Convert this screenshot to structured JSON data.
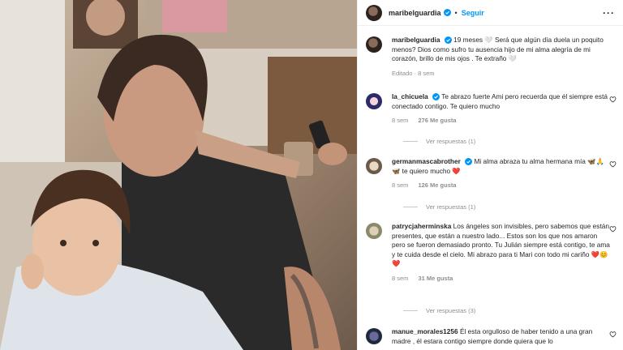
{
  "post": {
    "username": "maribelguardia",
    "follow_label": "Seguir",
    "caption_user": "maribelguardia",
    "caption_text": "19 meses 🤍 Será que algún día duela un poquito menos? Dios como sufro tu ausencia hijo de mi alma alegría de mi corazón, brillo de mis ojos . Te extraño 🤍",
    "edited": "Editado · 8 sem"
  },
  "comments": [
    {
      "user": "la_chicuela",
      "text": "Te abrazo fuerte Ami pero recuerda que él siempre está conectado contigo. Te quiero mucho",
      "time": "8 sem",
      "likes": "276 Me gusta",
      "replies": "Ver respuestas (1)"
    },
    {
      "user": "germanmascabrother",
      "text": "Mi alma abraza tu alma hermana mía 🦋🙏🦋 te quiero mucho ❤️",
      "time": "8 sem",
      "likes": "126 Me gusta",
      "replies": "Ver respuestas (1)"
    },
    {
      "user": "patrycjaherminska",
      "text": "Los ángeles son invisibles, pero sabemos que están presentes, que están a nuestro lado... Estos son los que nos amaron pero se fueron demasiado pronto. Tu Julián siempre está contigo, te ama y te cuida desde el cielo. Mi abrazo para ti Mari con todo mi cariño ❤️😊❤️",
      "time": "8 sem",
      "likes": "31 Me gusta",
      "replies": "Ver respuestas (3)"
    },
    {
      "user": "manue_morales1256",
      "text": "Él esta orgulloso de haber tenido a una gran madre , él estara contigo siempre donde quiera que lo"
    }
  ],
  "icons": {
    "verified": "verified-badge-icon",
    "more": "more-options-icon",
    "heart": "heart-outline-icon"
  },
  "colors": {
    "accent": "#0095f6",
    "text": "#262626",
    "muted": "#8e8e8e"
  }
}
